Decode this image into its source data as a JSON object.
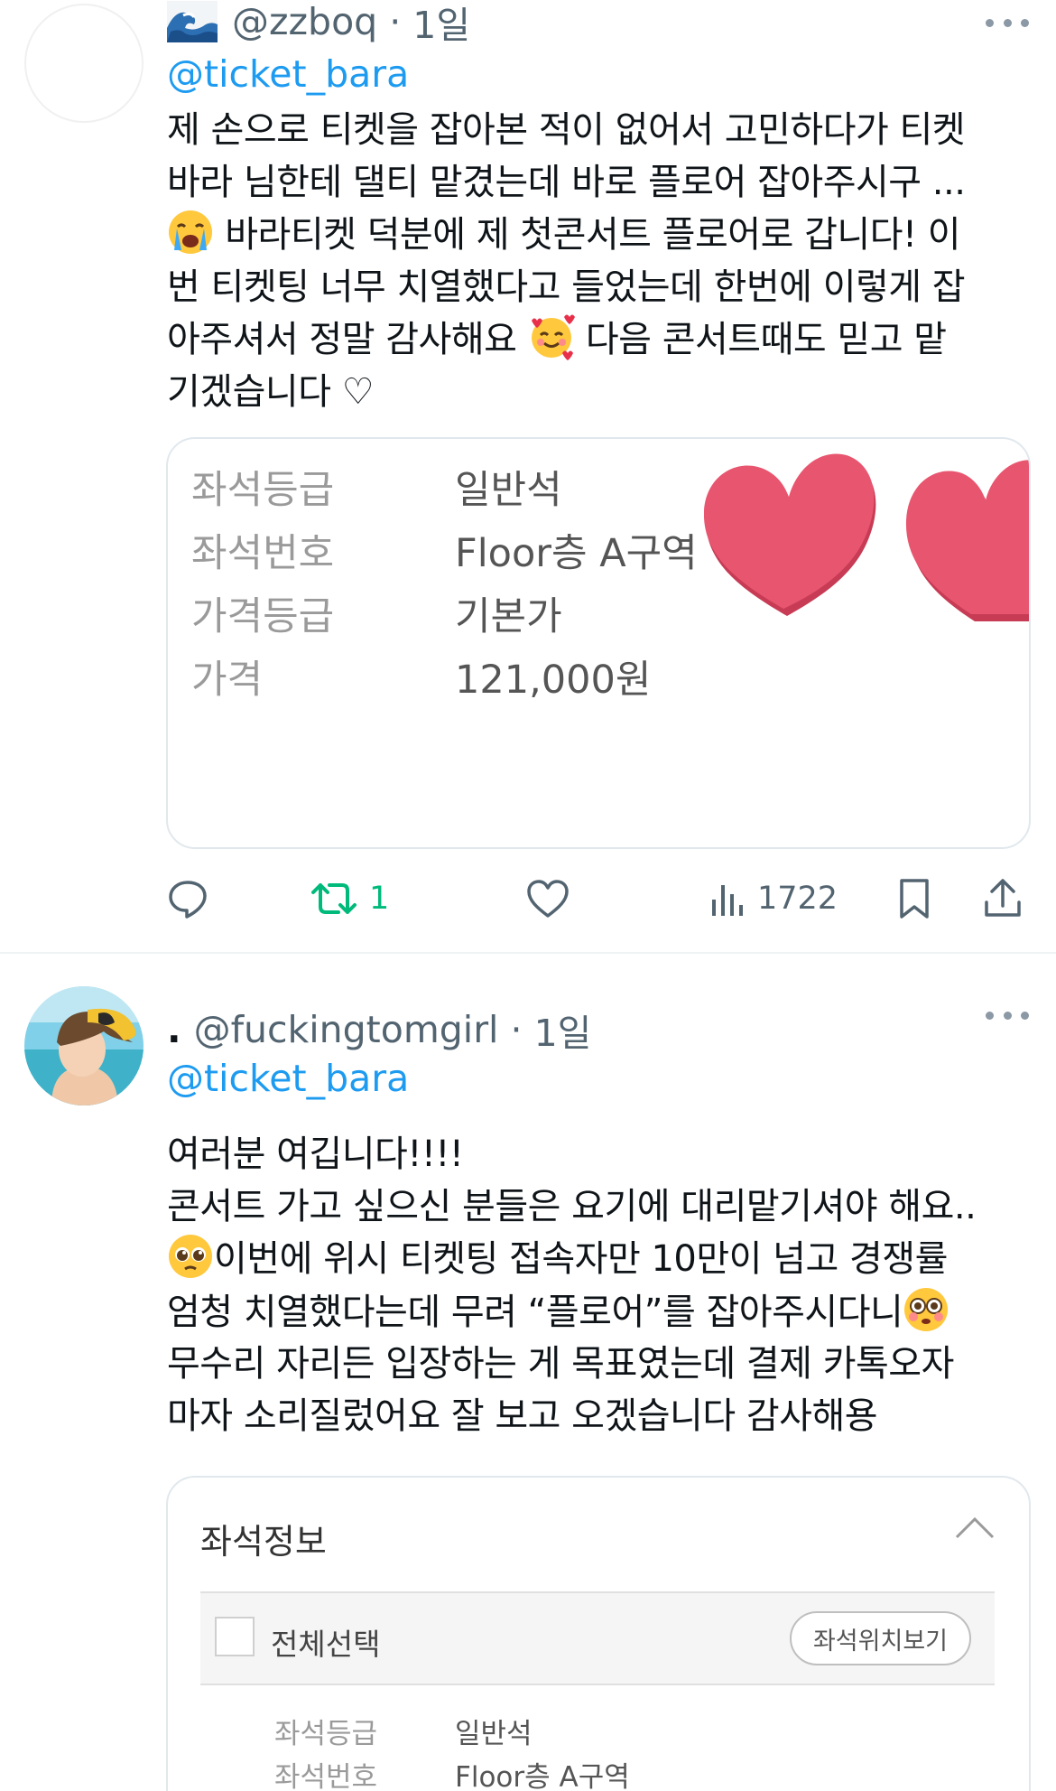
{
  "tweets": [
    {
      "handle": "@zzboq",
      "time": "1일",
      "reply_to": "@ticket_bara",
      "text_lines": [
        "제 손으로 티켓을 잡아본 적이 없어서 고민하다가 티켓",
        "바라 님한테 댈티 맡겼는데 바로 플로어 잡아주시구 ...",
        "바라티켓 덕분에 제 첫콘서트 플로어로 갑니다! 이",
        "번 티켓팅 너무 치열했다고 들었는데 한번에 이렇게 잡",
        "아주셔서 정말 감사해요",
        "다음 콘서트때도 믿고 맡",
        "기겠습니다 ♡"
      ],
      "seat_info": [
        {
          "label": "좌석등급",
          "value": "일반석"
        },
        {
          "label": "좌석번호",
          "value": "Floor층 A구역"
        },
        {
          "label": "가격등급",
          "value": "기본가"
        },
        {
          "label": "가격",
          "value": "121,000원"
        }
      ],
      "retweets": "1",
      "views": "1722"
    },
    {
      "display_name": ".",
      "handle": "@fuckingtomgirl",
      "time": "1일",
      "reply_to": "@ticket_bara",
      "text_lines": [
        "여러분 여깁니다!!!!",
        "콘서트 가고 싶으신 분들은 요기에 대리맡기셔야 해요..",
        "이번에 위시 티켓팅 접속자만 10만이 넘고 경쟁률",
        "엄청 치열했다는데 무려 “플로어”를 잡아주시다니",
        "무수리 자리든 입장하는 게 목표였는데 결제 카톡오자",
        "마자 소리질렀어요 잘 보고 오겠습니다 감사해용"
      ],
      "seat_panel": {
        "title": "좌석정보",
        "select_all": "전체선택",
        "location_button": "좌석위치보기",
        "rows": [
          {
            "label": "좌석등급",
            "value": "일반석"
          },
          {
            "label": "좌석번호",
            "value": "Floor층 A구역"
          }
        ]
      }
    }
  ],
  "icons": [
    "wave-emoji-icon",
    "crying-face-icon",
    "smiling-hearts-icon",
    "pleading-face-icon",
    "flushed-face-icon",
    "reply-icon",
    "retweet-icon",
    "like-icon",
    "views-icon",
    "bookmark-icon",
    "share-icon",
    "more-icon",
    "chevron-up-icon"
  ],
  "colors": {
    "link": "#1d9bf0",
    "retweet": "#00ba7c",
    "muted": "#536471",
    "heart_sticker": "#e8556f"
  }
}
